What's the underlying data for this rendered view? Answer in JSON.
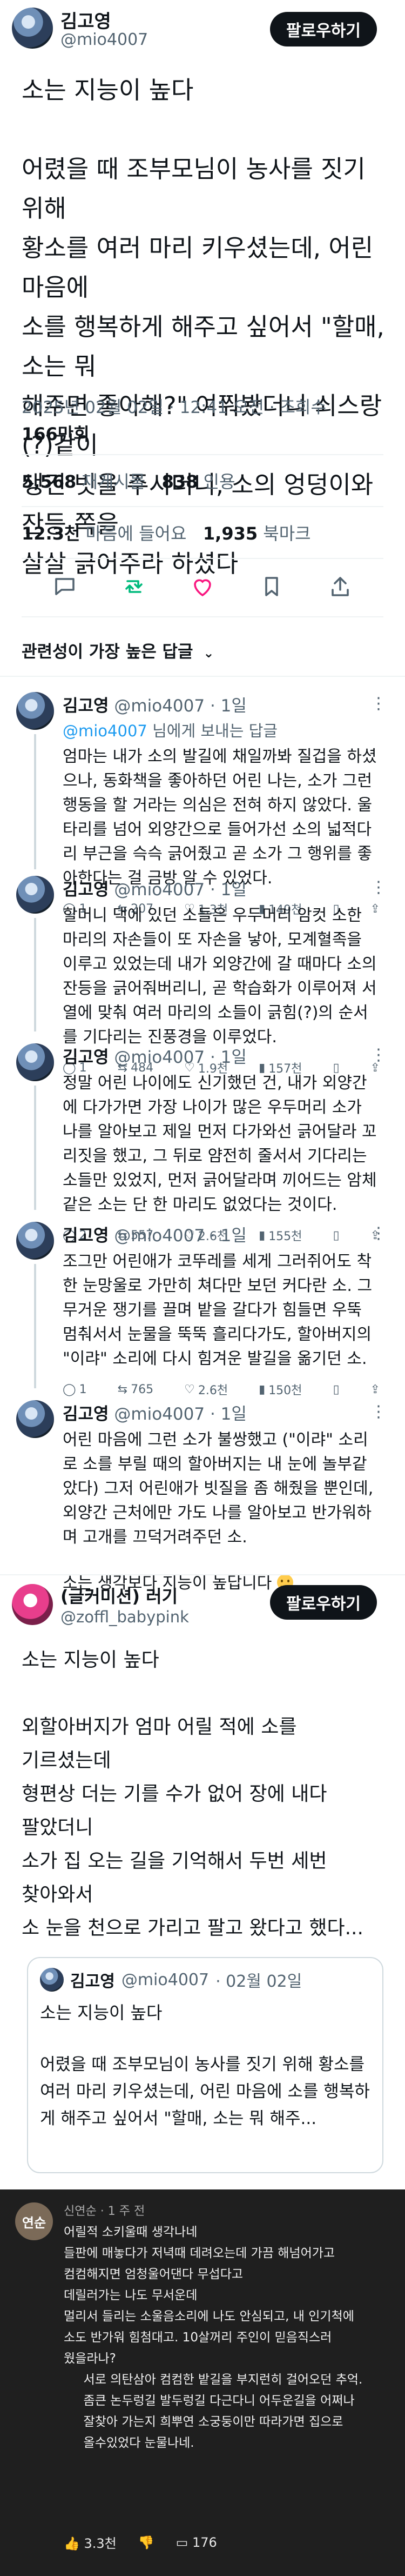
{
  "post": {
    "author_name": "김고영",
    "author_handle": "@mio4007",
    "follow_label": "팔로우하기",
    "text_lines": [
      "소는 지능이 높다",
      "",
      "어렸을 때 조부모님이 농사를 짓기 위해",
      "황소를 여러 마리 키우셨는데, 어린 마음에",
      "소를 행복하게 해주고 싶어서 \"할매, 소는 뭐",
      "해주면 좋아해?\" 여쭤봤더니 쇠스랑(?)같이",
      "생긴 빗을 주시더니, 소의 엉덩이와 잔등 쪽을",
      "살살 긁어주라 하셨다"
    ],
    "timestamp": "2025년 02월 02일 · 12:41 오전 · 조회수",
    "views": "166만회",
    "reposts_count": "5,568",
    "reposts_label": "재게시물",
    "quotes_count": "838",
    "quotes_label": "인용",
    "likes_count": "12.3천",
    "likes_label": "마음에 들어요",
    "bookmarks_count": "1,935",
    "bookmarks_label": "북마크"
  },
  "actions": {
    "reply_icon": "speech-bubble-icon",
    "repost_icon": "repost-icon",
    "like_icon": "heart-icon",
    "bookmark_icon": "bookmark-icon",
    "share_icon": "share-icon",
    "repost_color": "#00ba7c",
    "like_color": "#f91880"
  },
  "sort_label": "관련성이 가장 높은 답글",
  "replies": [
    {
      "name": "김고영",
      "handle": "@mio4007",
      "time": "· 1일",
      "sub_mention": "@mio4007",
      "sub_suffix": " 님에게 보내는 답글",
      "text": "엄마는 내가 소의 발길에 채일까봐 질겁을 하셨으나, 동화책을 좋아하던 어린 나는, 소가 그런 행동을 할 거라는 의심은 전혀 하지 않았다. 울타리를 넘어 외양간으로 들어가선 소의 넓적다리 부근을 슥슥 긁어줬고 곧 소가 그 행위를 좋아한다는 걸 금방 알 수 있었다.",
      "replies": "1",
      "reposts": "207",
      "likes": "1.3천",
      "views": "149천"
    },
    {
      "name": "김고영",
      "handle": "@mio4007",
      "time": "· 1일",
      "text": "할머니 댁에 있던 소들은 우두머리 암컷 소한 마리의 자손들이 또 자손을 낳아, 모계혈족을 이루고 있었는데 내가 외양간에 갈 때마다 소의 잔등을 긁어줘버리니, 곧 학습화가 이루어져 서열에 맞춰 여러 마리의 소들이 긁힘(?)의 순서를 기다리는 진풍경을 이루었다.",
      "replies": "1",
      "reposts": "484",
      "likes": "1.9천",
      "views": "157천"
    },
    {
      "name": "김고영",
      "handle": "@mio4007",
      "time": "· 1일",
      "text": "정말 어린 나이에도 신기했던 건, 내가 외양간에 다가가면 가장 나이가 많은 우두머리 소가 나를 알아보고 제일 먼저 다가와선 긁어달라 꼬리짓을 했고, 그 뒤로 얌전히 줄서서 기다리는 소들만 있었지, 먼저 긁어달라며 끼어드는 암체같은 소는 단 한 마리도 없었다는 것이다.",
      "replies": "2",
      "reposts": "557",
      "likes": "2.6천",
      "views": "155천"
    },
    {
      "name": "김고영",
      "handle": "@mio4007",
      "time": "· 1일",
      "text": "조그만 어린애가 코뚜레를 세게 그러쥐어도 착한 눈망울로 가만히 쳐다만 보던 커다란 소. 그 무거운 쟁기를 끌며 밭을 갈다가 힘들면 우뚝 멈춰서서 눈물을 뚝뚝 흘리다가도, 할아버지의 \"이랴\" 소리에 다시 힘겨운 발길을 옮기던 소.",
      "replies": "1",
      "reposts": "765",
      "likes": "2.6천",
      "views": "150천"
    },
    {
      "name": "김고영",
      "handle": "@mio4007",
      "time": "· 1일",
      "text": "어린 마음에 그런 소가 불쌍했고 (\"이랴\" 소리로 소를 부릴 때의 할아버지는 내 눈에 놀부같았다) 그저 어린애가 빗질을 좀 해줬을 뿐인데, 외양간 근처에만 가도 나를 알아보고 반가워하며 고개를 끄덕거려주던 소.",
      "text2": "소는 생각보다 지능이 높답니다"
    }
  ],
  "quote_post": {
    "name": "(글커미션) 러기",
    "handle": "@zoffl_babypink",
    "follow_label": "팔로우하기",
    "text_lines": [
      "소는 지능이 높다",
      "",
      "외할아버지가 엄마 어릴 적에 소를",
      "기르셨는데",
      "형편상 더는 기를 수가 없어 장에 내다",
      "팔았더니",
      "소가 집 오는 길을 기억해서 두번 세번",
      "찾아와서",
      "소 눈을 천으로 가리고 팔고 왔다고 했다..."
    ],
    "quoted": {
      "name": "김고영",
      "handle": "@mio4007",
      "date": "· 02월 02일",
      "title": "소는 지능이 높다",
      "text": "어렸을 때 조부모님이 농사를 짓기 위해 황소를 여러 마리 키우셨는데, 어린 마음에 소를 행복하게 해주고 싶어서 \"할매, 소는 뭐 해주..."
    }
  },
  "comment_overlay": {
    "avatar_label": "연순",
    "user": "신연순",
    "time": "· 1 주 전",
    "text_lines": [
      "어릴적 소키울때 생각나네",
      "들판에 매놓다가 저녁때 데려오는데 가끔 해넘어가고",
      "컴컴해지면 엄청울어댄다 무섭다고",
      "데릴러가는 나도 무서운데",
      "멀리서 들리는 소울음소리에 나도 안심되고, 내 인기척에",
      "소도 반가워 힘첨대고. 10살꺼리 주인이 믿음직스러",
      "웠을라나?",
      "     서로 의탄삼아 컴컴한 밭길을 부지런히 걸어오던 추억.",
      "     좀큰 논두렁길 발두렁길 다근다니 어두운길을 어쩌나",
      "     잘찾아 가는지 희뿌연 소궁둥이만 따라가면 집으로",
      "     올수있었다 눈물나네."
    ],
    "likes": "3.3천",
    "replies": "176"
  }
}
